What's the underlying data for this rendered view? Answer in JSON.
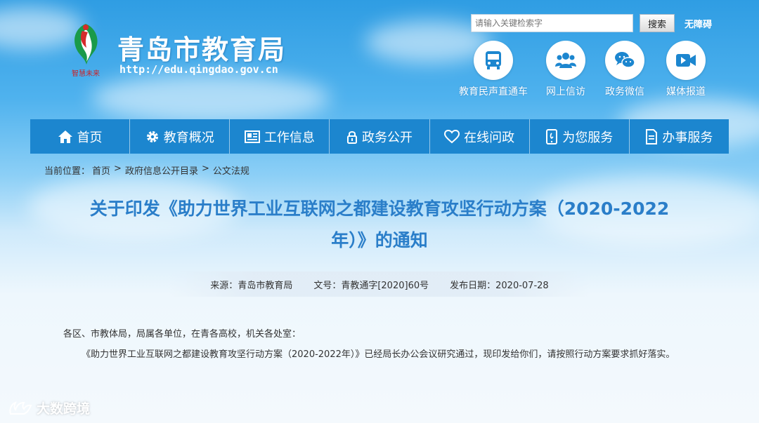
{
  "header": {
    "site_title": "青岛市教育局",
    "site_url": "http://edu.qingdao.gov.cn",
    "logo_text": "智慧未来",
    "search_placeholder": "请输入关键检索字",
    "search_button": "搜索",
    "accessibility_link": "无障碍"
  },
  "quick_links": [
    {
      "label": "教育民声直通车",
      "icon": "bus-icon"
    },
    {
      "label": "网上信访",
      "icon": "users-icon"
    },
    {
      "label": "政务微信",
      "icon": "wechat-icon"
    },
    {
      "label": "媒体报道",
      "icon": "video-icon"
    }
  ],
  "nav": [
    {
      "label": "首页",
      "icon": "home-icon"
    },
    {
      "label": "教育概况",
      "icon": "gear-icon"
    },
    {
      "label": "工作信息",
      "icon": "newspaper-icon"
    },
    {
      "label": "政务公开",
      "icon": "lock-icon"
    },
    {
      "label": "在线问政",
      "icon": "heart-icon"
    },
    {
      "label": "为您服务",
      "icon": "phone-icon"
    },
    {
      "label": "办事服务",
      "icon": "document-icon"
    }
  ],
  "breadcrumb": {
    "prefix": "当前位置：",
    "items": [
      "首页",
      "政府信息公开目录",
      "公文法规"
    ]
  },
  "article": {
    "title_line1": "关于印发《助力世界工业互联网之都建设教育攻坚行动方案（2020-2022",
    "title_line2": "年）》的通知",
    "source_label": "来源：",
    "source": "青岛市教育局",
    "doc_no_label": "文号：",
    "doc_no": "青教通字[2020]60号",
    "date_label": "发布日期：",
    "date": "2020-07-28",
    "salutation": "各区、市教体局，局属各单位，在青各高校，机关各处室：",
    "paragraph": "《助力世界工业互联网之都建设教育攻坚行动方案（2020-2022年）》已经局长办公会议研究通过，现印发给你们，请按照行动方案要求抓好落实。"
  },
  "watermark": "大数跨境",
  "colors": {
    "nav_bg": "#1c86cf",
    "title_blue": "#2a7ec9",
    "icon_blue": "#1c86cf"
  }
}
